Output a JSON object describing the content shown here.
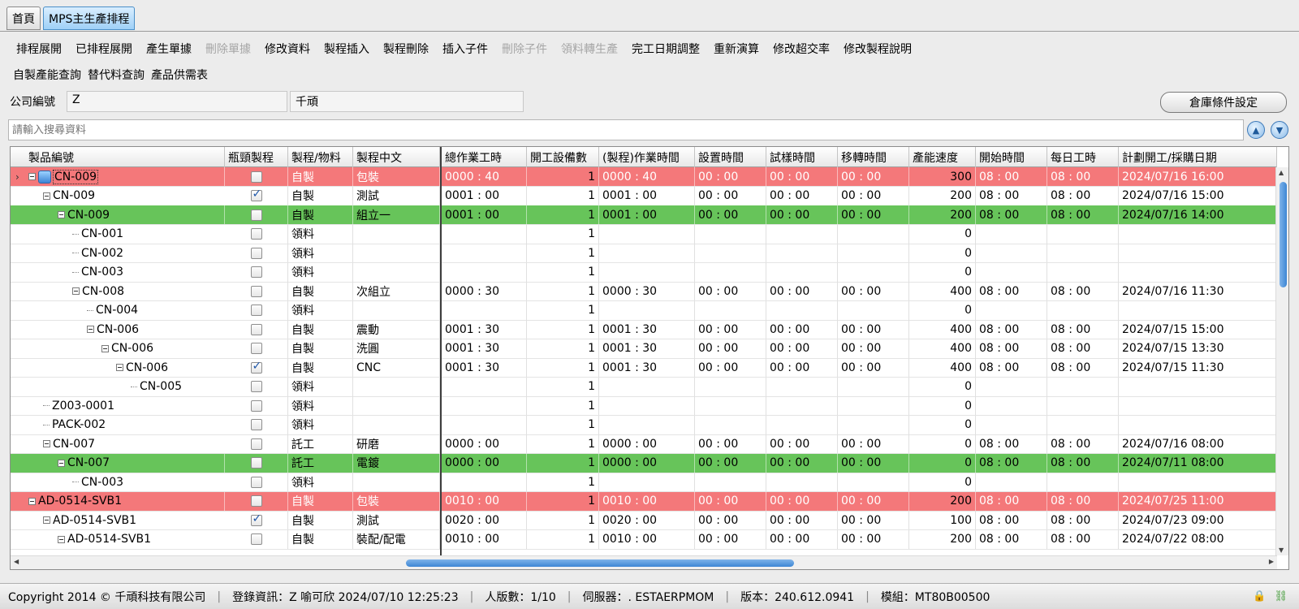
{
  "tabs": [
    {
      "label": "首頁",
      "active": false
    },
    {
      "label": "MPS主生產排程",
      "active": true
    }
  ],
  "toolbar": {
    "row1": [
      {
        "label": "排程展開",
        "disabled": false
      },
      {
        "label": "已排程展開",
        "disabled": false
      },
      {
        "label": "產生單據",
        "disabled": false
      },
      {
        "label": "刪除單據",
        "disabled": true
      },
      {
        "label": "修改資料",
        "disabled": false
      },
      {
        "label": "製程插入",
        "disabled": false
      },
      {
        "label": "製程刪除",
        "disabled": false
      },
      {
        "label": "插入子件",
        "disabled": false
      },
      {
        "label": "刪除子件",
        "disabled": true
      },
      {
        "label": "領料轉生產",
        "disabled": true
      },
      {
        "label": "完工日期調整",
        "disabled": false
      },
      {
        "label": "重新演算",
        "disabled": false
      },
      {
        "label": "修改超交率",
        "disabled": false
      },
      {
        "label": "修改製程說明",
        "disabled": false
      }
    ],
    "row2": [
      {
        "label": "自製產能查詢",
        "disabled": false
      },
      {
        "label": "替代料查詢",
        "disabled": false
      },
      {
        "label": "產品供需表",
        "disabled": false
      }
    ]
  },
  "company": {
    "label": "公司編號",
    "code": "Z",
    "name": "千頑"
  },
  "warehouse_button": "倉庫條件設定",
  "search": {
    "placeholder": "請輸入搜尋資料",
    "value": ""
  },
  "columns": [
    "製品編號",
    "瓶頸製程",
    "製程/物料",
    "製程中文",
    "總作業工時",
    "開工設備數",
    "(製程)作業時間",
    "設置時間",
    "試樣時間",
    "移轉時間",
    "產能速度",
    "開始時間",
    "每日工時",
    "計劃開工/採購日期"
  ],
  "rows": [
    {
      "level": 0,
      "exp": true,
      "icon": true,
      "id": "CN-009",
      "chk": false,
      "type": "自製",
      "proc": "包裝",
      "total": "0000 : 40",
      "dev": "1",
      "work": "0000 : 40",
      "setup": "00 : 00",
      "trial": "00 : 00",
      "move": "00 : 00",
      "speed": "300",
      "start": "08 : 00",
      "daily": "08 : 00",
      "date": "2024/07/16 16:00",
      "hl": "red",
      "current": true
    },
    {
      "level": 1,
      "exp": true,
      "id": "CN-009",
      "chk": true,
      "type": "自製",
      "proc": "測試",
      "total": "0001 : 00",
      "dev": "1",
      "work": "0001 : 00",
      "setup": "00 : 00",
      "trial": "00 : 00",
      "move": "00 : 00",
      "speed": "200",
      "start": "08 : 00",
      "daily": "08 : 00",
      "date": "2024/07/16 15:00",
      "hl": ""
    },
    {
      "level": 2,
      "exp": true,
      "id": "CN-009",
      "chk": false,
      "type": "自製",
      "proc": "組立一",
      "total": "0001 : 00",
      "dev": "1",
      "work": "0001 : 00",
      "setup": "00 : 00",
      "trial": "00 : 00",
      "move": "00 : 00",
      "speed": "200",
      "start": "08 : 00",
      "daily": "08 : 00",
      "date": "2024/07/16 14:00",
      "hl": "green"
    },
    {
      "level": 3,
      "exp": false,
      "id": "CN-001",
      "chk": false,
      "type": "領料",
      "proc": "",
      "total": "",
      "dev": "1",
      "work": "",
      "setup": "",
      "trial": "",
      "move": "",
      "speed": "0",
      "start": "",
      "daily": "",
      "date": "",
      "hl": ""
    },
    {
      "level": 3,
      "exp": false,
      "id": "CN-002",
      "chk": false,
      "type": "領料",
      "proc": "",
      "total": "",
      "dev": "1",
      "work": "",
      "setup": "",
      "trial": "",
      "move": "",
      "speed": "0",
      "start": "",
      "daily": "",
      "date": "",
      "hl": ""
    },
    {
      "level": 3,
      "exp": false,
      "id": "CN-003",
      "chk": false,
      "type": "領料",
      "proc": "",
      "total": "",
      "dev": "1",
      "work": "",
      "setup": "",
      "trial": "",
      "move": "",
      "speed": "0",
      "start": "",
      "daily": "",
      "date": "",
      "hl": ""
    },
    {
      "level": 3,
      "exp": true,
      "id": "CN-008",
      "chk": false,
      "type": "自製",
      "proc": "次組立",
      "total": "0000 : 30",
      "dev": "1",
      "work": "0000 : 30",
      "setup": "00 : 00",
      "trial": "00 : 00",
      "move": "00 : 00",
      "speed": "400",
      "start": "08 : 00",
      "daily": "08 : 00",
      "date": "2024/07/16 11:30",
      "hl": ""
    },
    {
      "level": 4,
      "exp": false,
      "id": "CN-004",
      "chk": false,
      "type": "領料",
      "proc": "",
      "total": "",
      "dev": "1",
      "work": "",
      "setup": "",
      "trial": "",
      "move": "",
      "speed": "0",
      "start": "",
      "daily": "",
      "date": "",
      "hl": ""
    },
    {
      "level": 4,
      "exp": true,
      "id": "CN-006",
      "chk": false,
      "type": "自製",
      "proc": "震動",
      "total": "0001 : 30",
      "dev": "1",
      "work": "0001 : 30",
      "setup": "00 : 00",
      "trial": "00 : 00",
      "move": "00 : 00",
      "speed": "400",
      "start": "08 : 00",
      "daily": "08 : 00",
      "date": "2024/07/15 15:00",
      "hl": ""
    },
    {
      "level": 5,
      "exp": true,
      "id": "CN-006",
      "chk": false,
      "type": "自製",
      "proc": "洗圓",
      "total": "0001 : 30",
      "dev": "1",
      "work": "0001 : 30",
      "setup": "00 : 00",
      "trial": "00 : 00",
      "move": "00 : 00",
      "speed": "400",
      "start": "08 : 00",
      "daily": "08 : 00",
      "date": "2024/07/15 13:30",
      "hl": ""
    },
    {
      "level": 6,
      "exp": true,
      "id": "CN-006",
      "chk": true,
      "type": "自製",
      "proc": "CNC",
      "total": "0001 : 30",
      "dev": "1",
      "work": "0001 : 30",
      "setup": "00 : 00",
      "trial": "00 : 00",
      "move": "00 : 00",
      "speed": "400",
      "start": "08 : 00",
      "daily": "08 : 00",
      "date": "2024/07/15 11:30",
      "hl": ""
    },
    {
      "level": 7,
      "exp": false,
      "id": "CN-005",
      "chk": false,
      "type": "領料",
      "proc": "",
      "total": "",
      "dev": "1",
      "work": "",
      "setup": "",
      "trial": "",
      "move": "",
      "speed": "0",
      "start": "",
      "daily": "",
      "date": "",
      "hl": ""
    },
    {
      "level": 1,
      "exp": false,
      "id": "Z003-0001",
      "chk": false,
      "type": "領料",
      "proc": "",
      "total": "",
      "dev": "1",
      "work": "",
      "setup": "",
      "trial": "",
      "move": "",
      "speed": "0",
      "start": "",
      "daily": "",
      "date": "",
      "hl": ""
    },
    {
      "level": 1,
      "exp": false,
      "id": "PACK-002",
      "chk": false,
      "type": "領料",
      "proc": "",
      "total": "",
      "dev": "1",
      "work": "",
      "setup": "",
      "trial": "",
      "move": "",
      "speed": "0",
      "start": "",
      "daily": "",
      "date": "",
      "hl": ""
    },
    {
      "level": 1,
      "exp": true,
      "id": "CN-007",
      "chk": false,
      "type": "託工",
      "proc": "研磨",
      "total": "0000 : 00",
      "dev": "1",
      "work": "0000 : 00",
      "setup": "00 : 00",
      "trial": "00 : 00",
      "move": "00 : 00",
      "speed": "0",
      "start": "08 : 00",
      "daily": "08 : 00",
      "date": "2024/07/16 08:00",
      "hl": ""
    },
    {
      "level": 2,
      "exp": true,
      "id": "CN-007",
      "chk": false,
      "type": "託工",
      "proc": "電鍍",
      "total": "0000 : 00",
      "dev": "1",
      "work": "0000 : 00",
      "setup": "00 : 00",
      "trial": "00 : 00",
      "move": "00 : 00",
      "speed": "0",
      "start": "08 : 00",
      "daily": "08 : 00",
      "date": "2024/07/11 08:00",
      "hl": "green"
    },
    {
      "level": 3,
      "exp": false,
      "id": "CN-003",
      "chk": false,
      "type": "領料",
      "proc": "",
      "total": "",
      "dev": "1",
      "work": "",
      "setup": "",
      "trial": "",
      "move": "",
      "speed": "0",
      "start": "",
      "daily": "",
      "date": "",
      "hl": ""
    },
    {
      "level": 0,
      "exp": true,
      "id": "AD-0514-SVB1",
      "chk": false,
      "type": "自製",
      "proc": "包裝",
      "total": "0010 : 00",
      "dev": "1",
      "work": "0010 : 00",
      "setup": "00 : 00",
      "trial": "00 : 00",
      "move": "00 : 00",
      "speed": "200",
      "start": "08 : 00",
      "daily": "08 : 00",
      "date": "2024/07/25 11:00",
      "hl": "red"
    },
    {
      "level": 1,
      "exp": true,
      "id": "AD-0514-SVB1",
      "chk": true,
      "type": "自製",
      "proc": "測試",
      "total": "0020 : 00",
      "dev": "1",
      "work": "0020 : 00",
      "setup": "00 : 00",
      "trial": "00 : 00",
      "move": "00 : 00",
      "speed": "100",
      "start": "08 : 00",
      "daily": "08 : 00",
      "date": "2024/07/23 09:00",
      "hl": ""
    },
    {
      "level": 2,
      "exp": true,
      "id": "AD-0514-SVB1",
      "chk": false,
      "type": "自製",
      "proc": "裝配/配電",
      "total": "0010 : 00",
      "dev": "1",
      "work": "0010 : 00",
      "setup": "00 : 00",
      "trial": "00 : 00",
      "move": "00 : 00",
      "speed": "200",
      "start": "08 : 00",
      "daily": "08 : 00",
      "date": "2024/07/22 08:00",
      "hl": ""
    }
  ],
  "status": {
    "copyright": "Copyright 2014 © 千頑科技有限公司",
    "login": "登錄資訊：Z 喻可欣 2024/07/10 12:25:23",
    "users": "人版數：1/10",
    "server": "伺服器：. ESTAERPMOM",
    "version": "版本：240.612.0941",
    "module": "模組：MT80B00500"
  },
  "colors": {
    "red_row": "#f4787a",
    "green_row": "#67c45a",
    "accent": "#3d86d4"
  },
  "icons": {
    "up": "scroll-up-icon",
    "down": "scroll-down-icon",
    "lock": "lock-icon",
    "link": "link-icon"
  }
}
